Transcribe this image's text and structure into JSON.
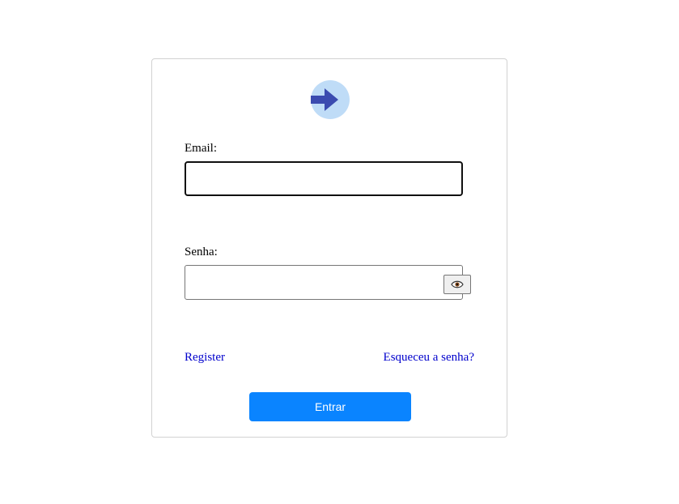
{
  "login": {
    "logo_icon": "arrow-right-icon",
    "email_label": "Email:",
    "email_value": "",
    "password_label": "Senha:",
    "password_value": "",
    "toggle_icon": "eye-icon",
    "register_link": "Register",
    "forgot_link": "Esqueceu a senha?",
    "submit_label": "Entrar"
  },
  "colors": {
    "primary": "#0a84ff",
    "logo_bg": "#bfdcf7",
    "logo_arrow": "#3b4bb0",
    "link": "#0000cc"
  }
}
